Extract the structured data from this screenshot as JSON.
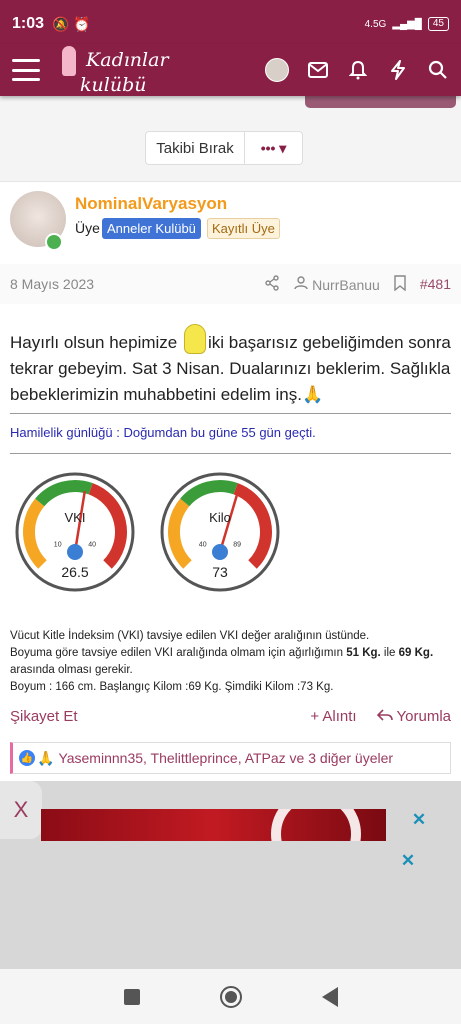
{
  "status": {
    "time": "1:03",
    "network": "4.5G",
    "battery": "45"
  },
  "header": {
    "logo_line1": "Kadınlar",
    "logo_line2": "kulübü"
  },
  "follow": {
    "label": "Takibi Bırak",
    "more_label": "••• ▾"
  },
  "post": {
    "username": "NominalVaryasyon",
    "role": "Üye",
    "badge_blue": "Anneler Kulübü",
    "badge_tan": "Kayıtlı Üye",
    "date": "8 Mayıs 2023",
    "author_link": "NurrBanuu",
    "post_number": "#481",
    "body_part1": "Hayırlı olsun hepimize ",
    "body_part2": "iki başarısız gebeliğimden sonra tekrar gebeyim. Sat 3 Nisan. Dualarınızı beklerim. Sağlıkla bebeklerimizin muhabbetini edelim inş.",
    "body_emoji": "🙏",
    "diary": "Hamilelik günlüğü : Doğumdan bu güne 55 gün geçti.",
    "gauge1": {
      "label": "VKI",
      "value": "26.5",
      "min": "10",
      "max": "40",
      "fraction": 0.55
    },
    "gauge2": {
      "label": "Kilo",
      "value": "73",
      "min": "40",
      "max": "89",
      "fraction": 0.59
    },
    "info_line1": "Vücut Kitle İndeksim (VKI) tavsiye edilen VKI değer aralığının üstünde.",
    "info_line2a": "Boyuma göre tavsiye edilen VKI aralığında olmam için ağırlığımın ",
    "info_line2b": "51 Kg.",
    "info_line2c": " ile ",
    "info_line2d": "69 Kg.",
    "info_line3": "arasında olması gerekir.",
    "info_line4": "Boyum : 166 cm. Başlangıç Kilom :69 Kg. Şimdiki Kilom :73 Kg.",
    "report": "Şikayet Et",
    "quote": "+ Alıntı",
    "reply": "Yorumla",
    "reactions": "Yaseminnn35, Thelittleprince, ATPaz ve 3 diğer üyeler"
  },
  "ad": {
    "x_label": "X",
    "close": "✕"
  },
  "colors": {
    "brand": "#8a1f45",
    "accent": "#f39a1b",
    "link": "#9a3a5f"
  }
}
